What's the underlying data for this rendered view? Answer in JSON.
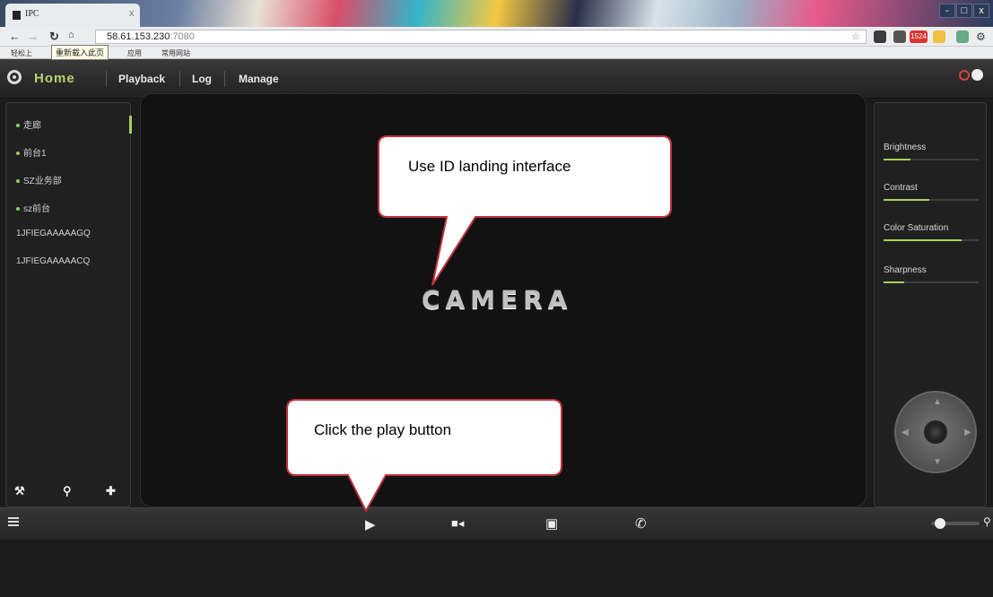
{
  "browser": {
    "tab_title": "IPC",
    "tab_close": "x",
    "address_host": "58.61.153.230",
    "address_port": ":7080",
    "tooltip": "重新载入此页",
    "bookmarks": [
      "轻松上",
      "应用",
      "常用网站"
    ],
    "notification_count": "1524",
    "window_controls": [
      "-",
      "x"
    ]
  },
  "app": {
    "nav": {
      "home": "Home",
      "items": [
        "Playback",
        "Log",
        "Manage"
      ]
    },
    "devices": [
      "走廊",
      "前台1",
      "SZ业务部",
      "sz前台",
      "1JFIEGAAAAAGQ",
      "1JFIEGAAAAACQ"
    ],
    "video": {
      "placeholder": "CAMERA"
    },
    "adjustments": [
      {
        "label": "Brightness",
        "level": 0.28
      },
      {
        "label": "Contrast",
        "level": 0.48
      },
      {
        "label": "Color Saturation",
        "level": 0.82
      },
      {
        "label": "Sharpness",
        "level": 0.22
      }
    ],
    "volume_level": 0.1
  },
  "annotations": {
    "top": "Use ID landing interface",
    "bottom": "Click the play button"
  },
  "colors": {
    "accent": "#a6d05a",
    "callout_border": "#c0313f",
    "background": "#1b1b1b"
  },
  "icons": [
    "reload-icon",
    "home-icon",
    "wrench-icon",
    "search-icon",
    "plus-icon",
    "play-icon",
    "record-icon",
    "snapshot-icon",
    "phone-icon",
    "list-icon",
    "power-icon",
    "user-icon",
    "ptz-control-icon"
  ]
}
